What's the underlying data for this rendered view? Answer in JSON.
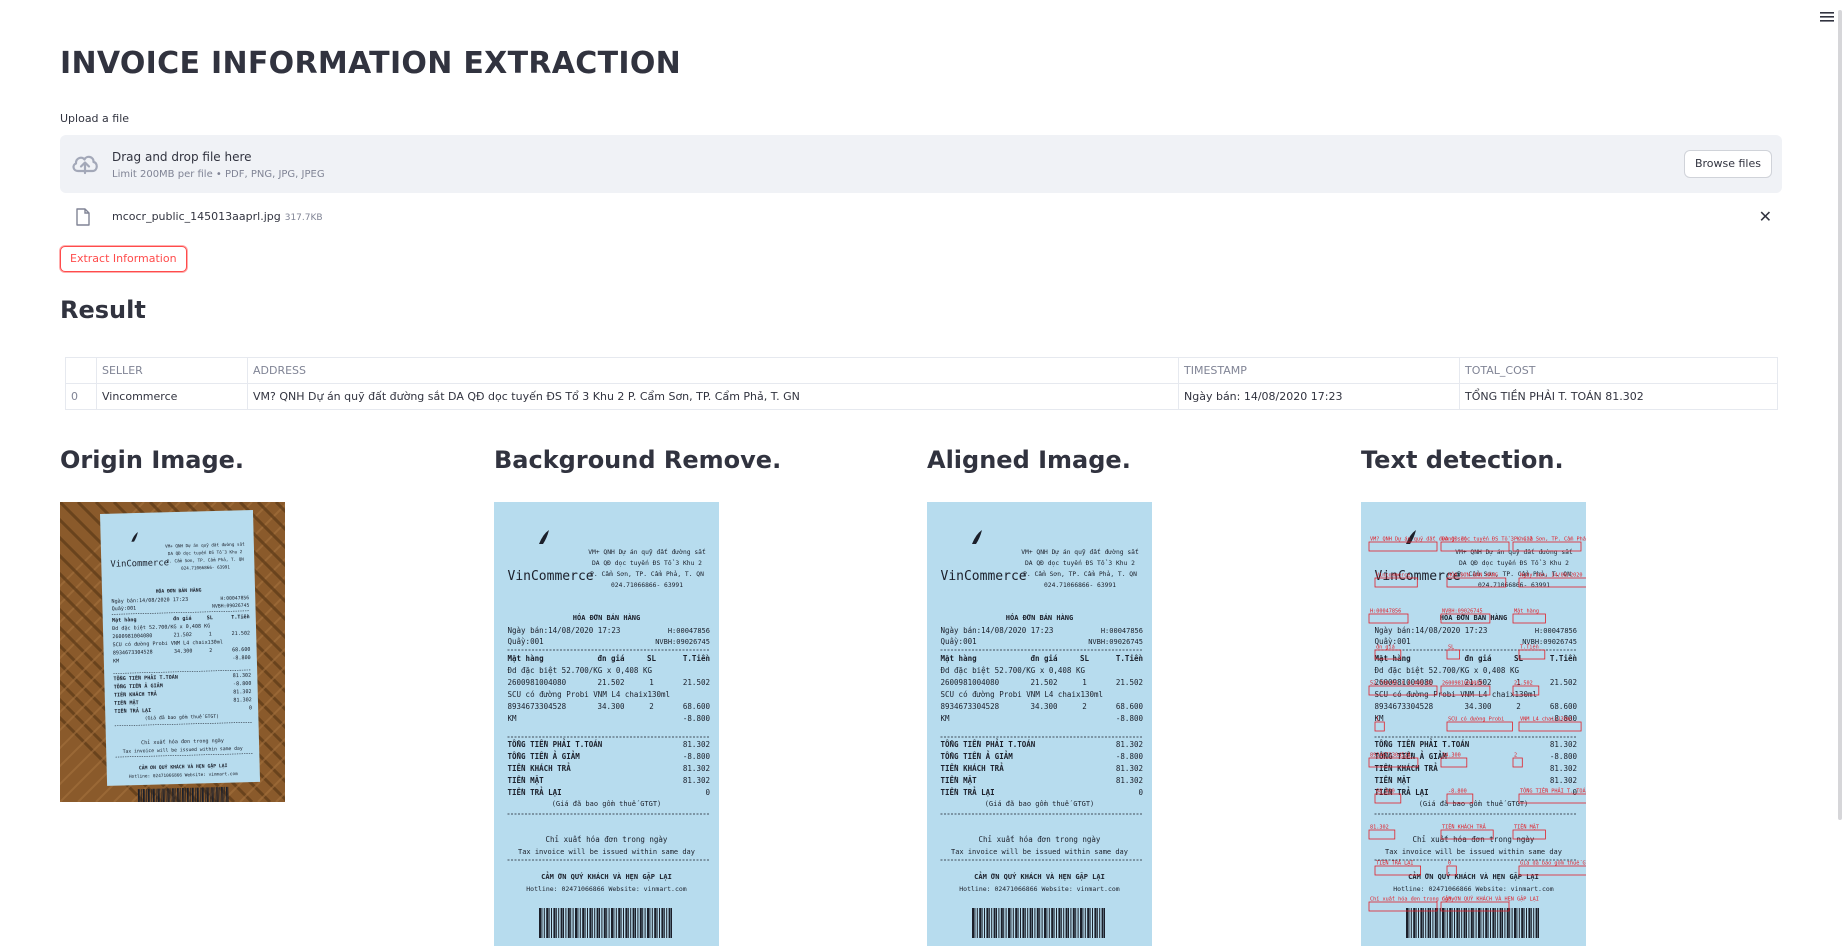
{
  "header": {
    "title": "INVOICE INFORMATION EXTRACTION",
    "menu_icon": "hamburger-icon"
  },
  "upload": {
    "label": "Upload a file",
    "drop_text": "Drag and drop file here",
    "limit_text": "Limit 200MB per file • PDF, PNG, JPG, JPEG",
    "browse_label": "Browse files",
    "file": {
      "name": "mcocr_public_145013aaprl.jpg",
      "size": "317.7KB"
    }
  },
  "actions": {
    "extract_label": "Extract Information",
    "accent": "#ff4b4b"
  },
  "result": {
    "heading": "Result",
    "columns": [
      "SELLER",
      "ADDRESS",
      "TIMESTAMP",
      "TOTAL_COST"
    ],
    "rows": [
      {
        "index": "0",
        "seller": "Vincommerce",
        "address": "VM? QNH Dự án quỹ đất đường sắt DA QĐ dọc tuyến ĐS Tổ 3 Khu 2 P. Cẩm Sơn, TP. Cẩm Phả, T. GN",
        "timestamp": "Ngày bán: 14/08/2020 17:23",
        "total_cost": "TỔNG TIỀN PHẢI T. TOÁN 81.302"
      }
    ]
  },
  "panels": [
    {
      "heading": "Origin Image."
    },
    {
      "heading": "Background Remove."
    },
    {
      "heading": "Aligned Image."
    },
    {
      "heading": "Text detection."
    }
  ],
  "receipt": {
    "brand": "VinCommerce",
    "store_lines": [
      "VM+ QNH Dự án quỹ đất đường sắt",
      "DA QĐ dọc tuyến ĐS Tổ 3 Khu 2",
      "P. Cẩm Sơn, TP. Cẩm Phả, T. QN",
      "024.71066866- 63991"
    ],
    "doc_title": "HÓA ĐƠN BÁN HÀNG",
    "sale_date": "Ngày bán:14/08/2020 17:23",
    "invoice_no": "H:00047856",
    "counter": "Quầy:001",
    "staff": "NVBH:09026745",
    "col_headers": [
      "Mặt hàng",
      "đn giá",
      "SL",
      "T.Tiền"
    ],
    "items": [
      [
        "Đd đặc biệt 52.700/KG x 0,408 KG",
        "",
        "",
        ""
      ],
      [
        "2600981004080",
        "21.502",
        "1",
        "21.502"
      ],
      [
        "SCU có đường Probi VNM L4 chaix130ml",
        "",
        "",
        ""
      ],
      [
        "8934673304528",
        "34.300",
        "2",
        "68.600"
      ],
      [
        "KM",
        "",
        "",
        "-8.800"
      ]
    ],
    "totals": [
      [
        "TỔNG TIỀN PHẢI T.TOÁN",
        "81.302"
      ],
      [
        "TỔNG TIỀN Ả GIẢM",
        "-8.800"
      ],
      [
        "TIỀN KHÁCH TRẢ",
        "81.302"
      ],
      [
        " TIỀN MẶT",
        "81.302"
      ],
      [
        "TIỀN TRẢ LẠI",
        "0"
      ]
    ],
    "vat_note": "(Giá đã bao gồm thuế GTGT)",
    "footer_vn": "Chỉ xuất hóa đơn trong ngày",
    "footer_en": "Tax invoice will be issued within same day",
    "thanks": "CẢM ƠN QUÝ KHÁCH VÀ HẸN GẶP LẠI",
    "contact": "Hotline: 02471066866 Website: vinmart.com"
  },
  "detections": [
    "VM? QNH Dự án quỹ đất đường sắt",
    "DA QĐ dọc tuyến ĐS Tổ 3 Khu 2",
    "P. Cẩm Sơn, TP. Cẩm Phả, T. GN",
    "Vincommerce",
    "HÓA ĐƠN BÁN HÀNG",
    "Ngày bán: 14/08/2020 17:23",
    "H:00047856",
    "NVBH:09026745",
    "Mặt hàng",
    "đn giá",
    "SL",
    "T.Tiền",
    "52.700/KG X 0,408 KG",
    "2600981004080",
    "21.502",
    "1",
    "SCU có đường Probi",
    "VNM L4 chaix130ml",
    "8934673304528",
    "34.300",
    "2",
    "68.600",
    "-8.800",
    "TỔNG TIỀN PHẢI T. TOÁN",
    "81.302",
    "TIỀN KHÁCH TRẢ",
    "TIỀN MẶT",
    "TIỀN TRẢ LẠI",
    "0",
    "Giá đã bao gồm thuế GTGT",
    "Chỉ xuất hóa đơn trong ngày",
    "CẢM ƠN QUÝ KHÁCH VÀ HẸN GẶP LẠI"
  ],
  "colors": {
    "wood": "#8a5a2b",
    "paper": "#b7dcee",
    "detect": "#e0202a"
  }
}
